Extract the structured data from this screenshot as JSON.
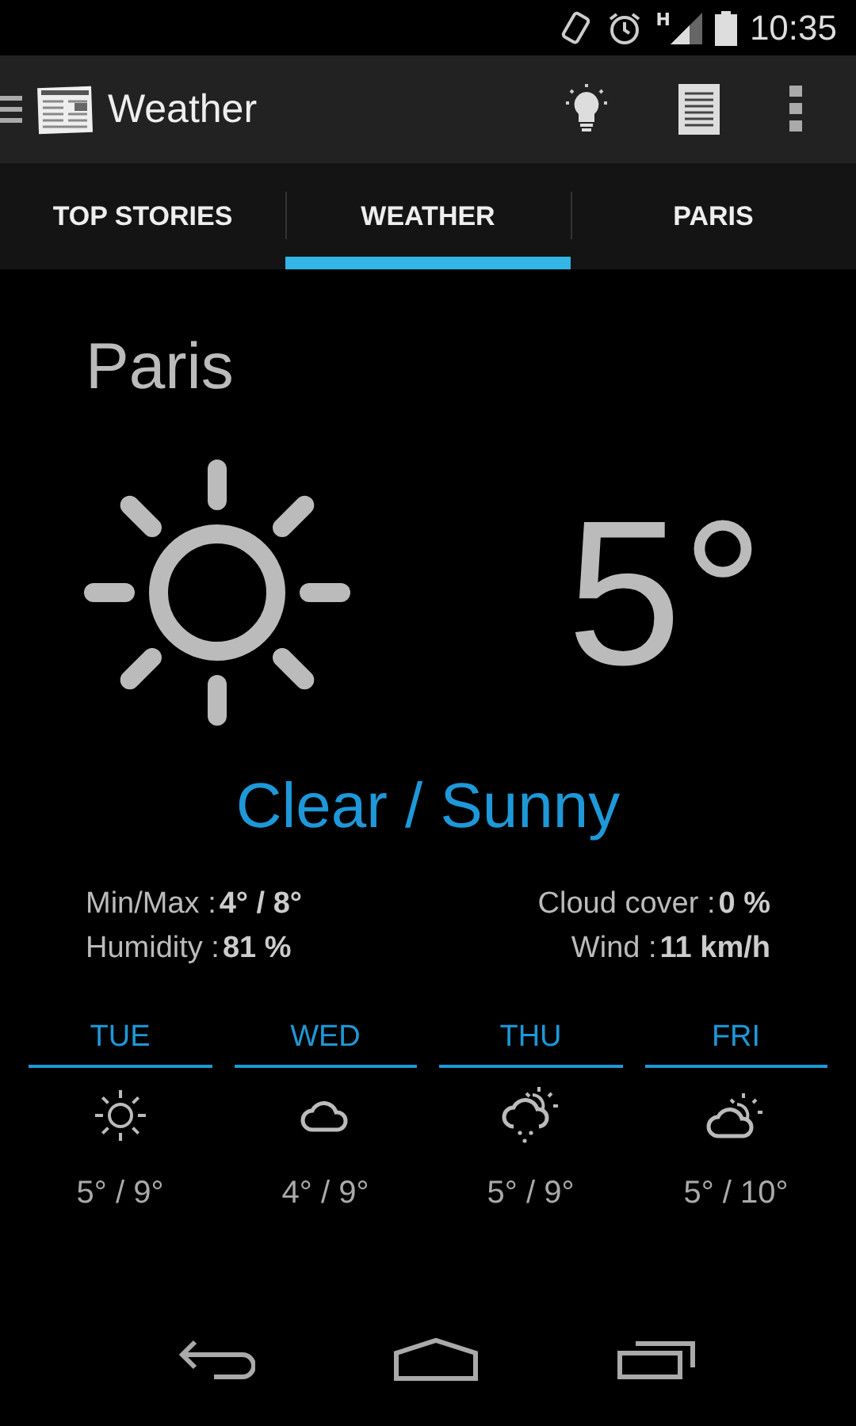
{
  "status_bar": {
    "time": "10:35",
    "network": "H"
  },
  "action_bar": {
    "title": "Weather"
  },
  "tabs": [
    {
      "label": "TOP STORIES",
      "selected": false
    },
    {
      "label": "WEATHER",
      "selected": true
    },
    {
      "label": "PARIS",
      "selected": false
    }
  ],
  "weather": {
    "city": "Paris",
    "temperature": "5°",
    "condition": "Clear / Sunny",
    "stats_left": [
      {
        "label": "Min/Max :",
        "value": "4° / 8°"
      },
      {
        "label": "Humidity :",
        "value": "81 %"
      }
    ],
    "stats_right": [
      {
        "label": "Cloud cover :",
        "value": "0 %"
      },
      {
        "label": "Wind :",
        "value": "11 km/h"
      }
    ]
  },
  "forecast": [
    {
      "day": "TUE",
      "kind": "sun",
      "temps": "5° / 9°"
    },
    {
      "day": "WED",
      "kind": "cloud",
      "temps": "4° / 9°"
    },
    {
      "day": "THU",
      "kind": "sun-cloud-rain",
      "temps": "5° / 9°"
    },
    {
      "day": "FRI",
      "kind": "sun-cloud",
      "temps": "5° / 10°"
    }
  ]
}
